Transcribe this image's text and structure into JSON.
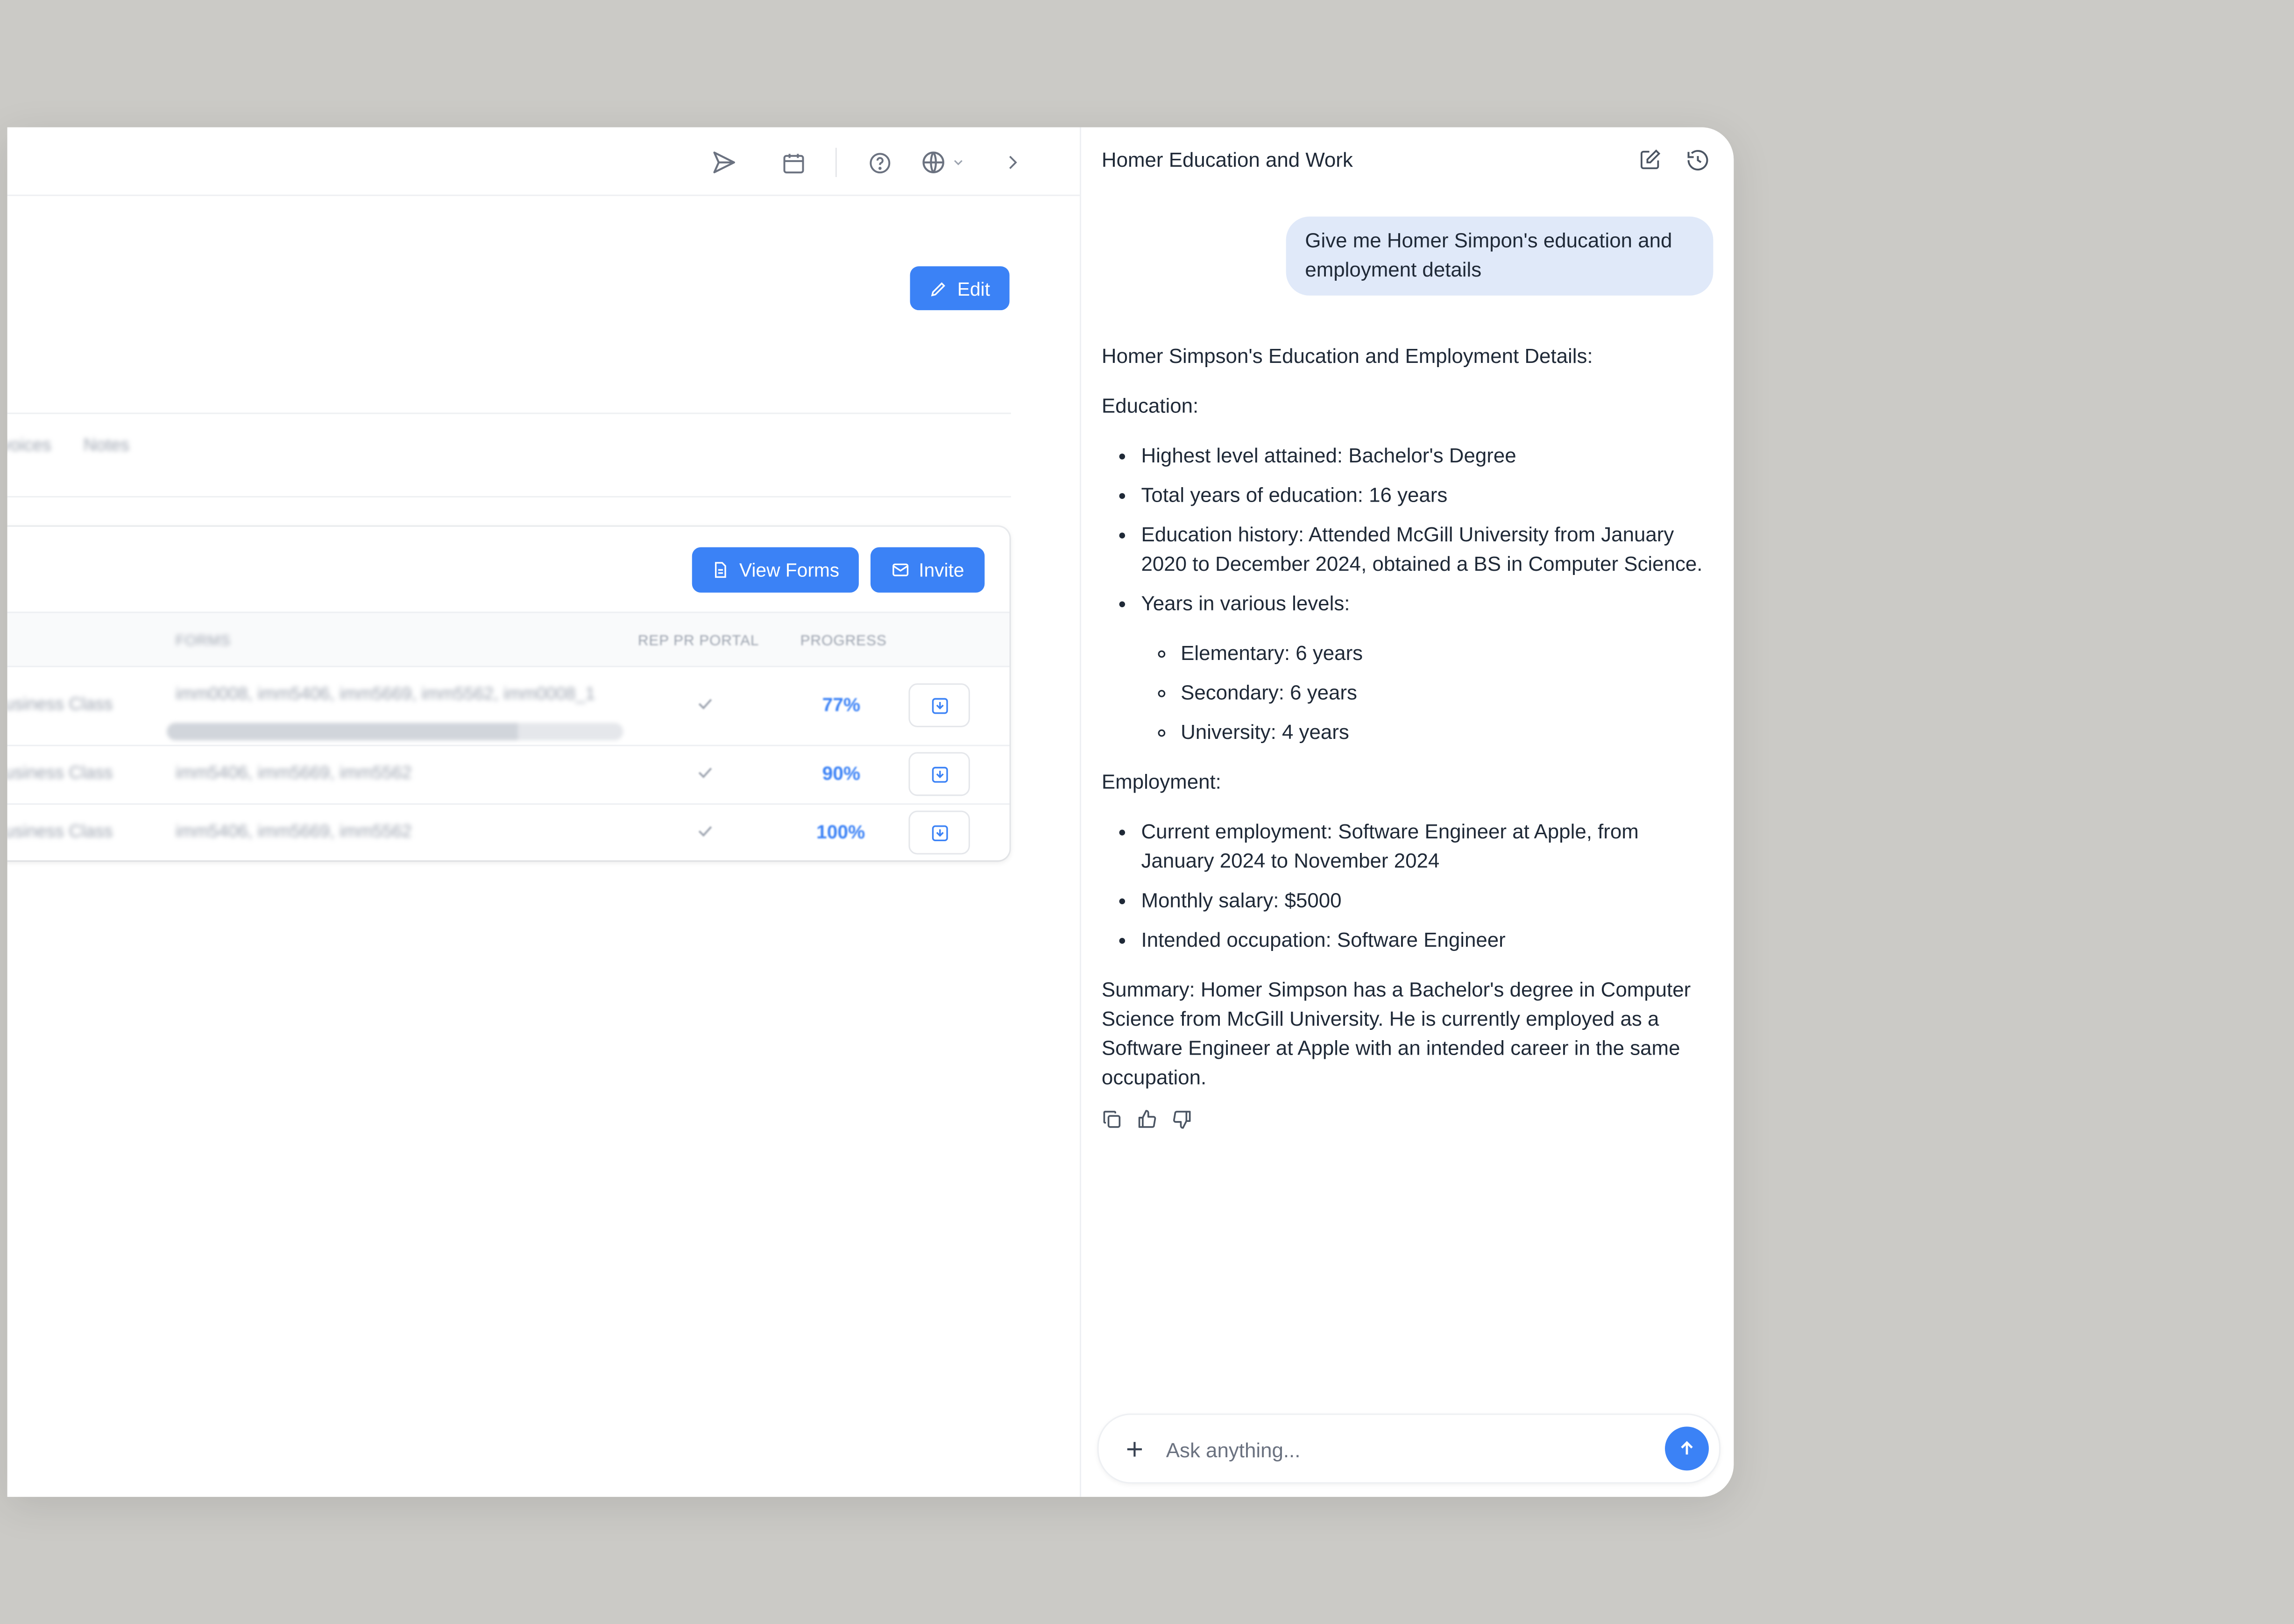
{
  "left_panel": {
    "edit_label": "Edit",
    "tabs": [
      "Invoices",
      "Notes"
    ],
    "card": {
      "view_forms_label": "View Forms",
      "invite_label": "Invite",
      "columns": [
        "FORMS",
        "REP PR PORTAL",
        "PROGRESS"
      ],
      "rows": [
        {
          "type": "Business Class",
          "forms": "imm0008, imm5406, imm5669, imm5562, imm0008_1",
          "progress_label": "77%",
          "progress": 0.77
        },
        {
          "type": "Business Class",
          "forms": "imm5406, imm5669, imm5562",
          "progress_label": "90%",
          "progress": 0.9
        },
        {
          "type": "Business Class",
          "forms": "imm5406, imm5669, imm5562",
          "progress_label": "100%",
          "progress": 1.0
        }
      ]
    }
  },
  "chat": {
    "title": "Homer Education and Work",
    "user_message": "Give me Homer Simpon's education and employment details",
    "answer": {
      "heading": "Homer Simpson's Education and Employment Details:",
      "education_label": "Education:",
      "education_items": [
        "Highest level attained: Bachelor's Degree",
        "Total years of education: 16 years",
        "Education history: Attended McGill University from January 2020 to December 2024, obtained a BS in Computer Science.",
        "Years in various levels:"
      ],
      "levels": [
        "Elementary: 6 years",
        "Secondary: 6 years",
        "University: 4 years"
      ],
      "employment_label": "Employment:",
      "employment_items": [
        "Current employment: Software Engineer at Apple, from January 2024 to November 2024",
        "Monthly salary: $5000",
        "Intended occupation: Software Engineer"
      ],
      "summary": "Summary: Homer Simpson has a Bachelor's degree in Computer Science from McGill University. He is currently employed as a Software Engineer at Apple with an intended career in the same occupation."
    },
    "input_placeholder": "Ask anything..."
  },
  "colors": {
    "accent": "#3b82f6",
    "user_bubble": "#e0e9f9",
    "backdrop": "#cbcac6"
  },
  "icons": [
    "send-icon",
    "calendar-icon",
    "help-icon",
    "globe-icon",
    "chevron-down-icon",
    "chevron-right-icon",
    "pencil-icon",
    "file-icon",
    "mail-icon",
    "check-icon",
    "download-icon",
    "new-chat-icon",
    "history-icon",
    "copy-icon",
    "thumbs-up-icon",
    "thumbs-down-icon",
    "plus-icon",
    "arrow-up-icon"
  ]
}
